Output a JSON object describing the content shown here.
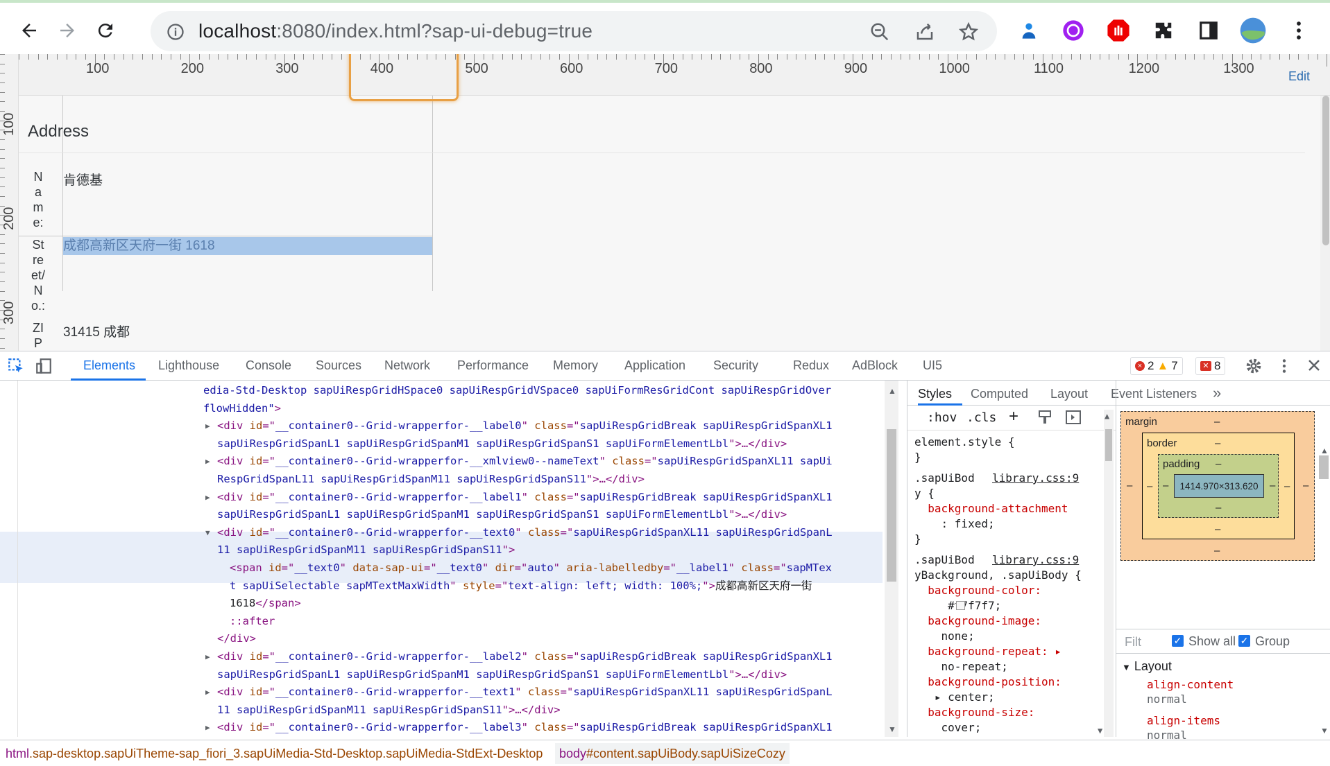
{
  "browser": {
    "url_host": "localhost",
    "url_rest": ":8080/index.html?sap-ui-debug=true",
    "icons": [
      "back-arrow-icon",
      "forward-arrow-icon",
      "reload-icon",
      "info-icon",
      "zoom-out-icon",
      "share-icon",
      "star-icon",
      "extension-person-icon",
      "extension-purple-icon",
      "adblock-icon",
      "puzzle-icon",
      "sidepanel-icon",
      "profile-avatar",
      "kebab-menu-icon"
    ]
  },
  "page": {
    "ruler_top_labels": [
      "100",
      "200",
      "300",
      "400",
      "500",
      "600",
      "700",
      "800",
      "900",
      "1000",
      "1100",
      "1200",
      "1300"
    ],
    "ruler_left_labels": [
      "100",
      "200",
      "300"
    ],
    "edit_link": "Edit",
    "form_title": "Address",
    "fields": [
      {
        "label_lines": [
          "N",
          "a",
          "m",
          "e:"
        ],
        "value": "肯德基"
      },
      {
        "label_lines": [
          "St",
          "re",
          "et/",
          "N",
          "o.:"
        ],
        "value": "成都高新区天府一街 1618"
      },
      {
        "label_lines": [
          "ZI",
          "P"
        ],
        "value": "31415 成都"
      }
    ]
  },
  "devtools": {
    "tabs": [
      "Elements",
      "Lighthouse",
      "Console",
      "Sources",
      "Network",
      "Performance",
      "Memory",
      "Application",
      "Security",
      "Redux",
      "AdBlock",
      "UI5"
    ],
    "active_tab": "Elements",
    "errors": "2",
    "warnings": "7",
    "issues": "8",
    "elements": {
      "lines": [
        {
          "parts": [
            [
              "aval",
              "edia-Std-Desktop sapUiRespGridHSpace0 sapUiRespGridVSpace0 sapUiFormResGridCont sapUiRespGridOver"
            ]
          ]
        },
        {
          "parts": [
            [
              "aval",
              "flowHidden\""
            ],
            [
              "tag",
              ">"
            ]
          ]
        },
        {
          "parts": [
            [
              "tag",
              "<div "
            ],
            [
              "attr",
              "id"
            ],
            [
              "tag",
              "=\""
            ],
            [
              "aval",
              "__container0--Grid-wrapperfor-__label0"
            ],
            [
              "tag",
              "\" "
            ],
            [
              "attr",
              "class"
            ],
            [
              "tag",
              "=\""
            ],
            [
              "aval",
              "sapUiRespGridBreak sapUiRespGridSpanXL1"
            ]
          ]
        },
        {
          "parts": [
            [
              "aval",
              "sapUiRespGridSpanL1 sapUiRespGridSpanM1 sapUiRespGridSpanS1 sapUiFormElementLbl"
            ],
            [
              "tag",
              "\">…</div>"
            ]
          ]
        },
        {
          "parts": [
            [
              "tag",
              "<div "
            ],
            [
              "attr",
              "id"
            ],
            [
              "tag",
              "=\""
            ],
            [
              "aval",
              "__container0--Grid-wrapperfor-__xmlview0--nameText"
            ],
            [
              "tag",
              "\" "
            ],
            [
              "attr",
              "class"
            ],
            [
              "tag",
              "=\""
            ],
            [
              "aval",
              "sapUiRespGridSpanXL11 sapUi"
            ]
          ]
        },
        {
          "parts": [
            [
              "aval",
              "RespGridSpanL11 sapUiRespGridSpanM11 sapUiRespGridSpanS11"
            ],
            [
              "tag",
              "\">…</div>"
            ]
          ]
        },
        {
          "parts": [
            [
              "tag",
              "<div "
            ],
            [
              "attr",
              "id"
            ],
            [
              "tag",
              "=\""
            ],
            [
              "aval",
              "__container0--Grid-wrapperfor-__label1"
            ],
            [
              "tag",
              "\" "
            ],
            [
              "attr",
              "class"
            ],
            [
              "tag",
              "=\""
            ],
            [
              "aval",
              "sapUiRespGridBreak sapUiRespGridSpanXL1"
            ]
          ]
        },
        {
          "parts": [
            [
              "aval",
              "sapUiRespGridSpanL1 sapUiRespGridSpanM1 sapUiRespGridSpanS1 sapUiFormElementLbl"
            ],
            [
              "tag",
              "\">…</div>"
            ]
          ]
        },
        {
          "parts": [
            [
              "tag",
              "<div "
            ],
            [
              "attr",
              "id"
            ],
            [
              "tag",
              "=\""
            ],
            [
              "aval",
              "__container0--Grid-wrapperfor-__text0"
            ],
            [
              "tag",
              "\" "
            ],
            [
              "attr",
              "class"
            ],
            [
              "tag",
              "=\""
            ],
            [
              "aval",
              "sapUiRespGridSpanXL11 sapUiRespGridSpanL"
            ]
          ]
        },
        {
          "parts": [
            [
              "aval",
              "11 sapUiRespGridSpanM11 sapUiRespGridSpanS11"
            ],
            [
              "tag",
              "\">"
            ]
          ]
        },
        {
          "parts": [
            [
              "tag",
              "<span "
            ],
            [
              "attr",
              "id"
            ],
            [
              "tag",
              "=\""
            ],
            [
              "aval",
              "__text0"
            ],
            [
              "tag",
              "\" "
            ],
            [
              "attr",
              "data-sap-ui"
            ],
            [
              "tag",
              "=\""
            ],
            [
              "aval",
              "__text0"
            ],
            [
              "tag",
              "\" "
            ],
            [
              "attr",
              "dir"
            ],
            [
              "tag",
              "=\""
            ],
            [
              "aval",
              "auto"
            ],
            [
              "tag",
              "\" "
            ],
            [
              "attr",
              "aria-labelledby"
            ],
            [
              "tag",
              "=\""
            ],
            [
              "aval",
              "__label1"
            ],
            [
              "tag",
              "\" "
            ],
            [
              "attr",
              "class"
            ],
            [
              "tag",
              "=\""
            ],
            [
              "aval",
              "sapMTex"
            ]
          ]
        },
        {
          "parts": [
            [
              "aval",
              "t sapUiSelectable sapMTextMaxWidth"
            ],
            [
              "tag",
              "\" "
            ],
            [
              "attr",
              "style"
            ],
            [
              "tag",
              "=\""
            ],
            [
              "aval",
              "text-align: left; width: 100%;"
            ],
            [
              "tag",
              "\">"
            ],
            [
              "txt",
              "成都高新区天府一街"
            ]
          ]
        },
        {
          "parts": [
            [
              "txt",
              "1618"
            ],
            [
              "tag",
              "</span>"
            ]
          ]
        },
        {
          "parts": [
            [
              "tag",
              "::after"
            ]
          ]
        },
        {
          "parts": [
            [
              "tag",
              "</div>"
            ]
          ]
        },
        {
          "parts": [
            [
              "tag",
              "<div "
            ],
            [
              "attr",
              "id"
            ],
            [
              "tag",
              "=\""
            ],
            [
              "aval",
              "__container0--Grid-wrapperfor-__label2"
            ],
            [
              "tag",
              "\" "
            ],
            [
              "attr",
              "class"
            ],
            [
              "tag",
              "=\""
            ],
            [
              "aval",
              "sapUiRespGridBreak sapUiRespGridSpanXL1"
            ]
          ]
        },
        {
          "parts": [
            [
              "aval",
              "sapUiRespGridSpanL1 sapUiRespGridSpanM1 sapUiRespGridSpanS1 sapUiFormElementLbl"
            ],
            [
              "tag",
              "\">…</div>"
            ]
          ]
        },
        {
          "parts": [
            [
              "tag",
              "<div "
            ],
            [
              "attr",
              "id"
            ],
            [
              "tag",
              "=\""
            ],
            [
              "aval",
              "__container0--Grid-wrapperfor-__text1"
            ],
            [
              "tag",
              "\" "
            ],
            [
              "attr",
              "class"
            ],
            [
              "tag",
              "=\""
            ],
            [
              "aval",
              "sapUiRespGridSpanXL11 sapUiRespGridSpanL"
            ]
          ]
        },
        {
          "parts": [
            [
              "aval",
              "11 sapUiRespGridSpanM11 sapUiRespGridSpanS11"
            ],
            [
              "tag",
              "\">…</div>"
            ]
          ]
        },
        {
          "parts": [
            [
              "tag",
              "<div "
            ],
            [
              "attr",
              "id"
            ],
            [
              "tag",
              "=\""
            ],
            [
              "aval",
              "__container0--Grid-wrapperfor-__label3"
            ],
            [
              "tag",
              "\" "
            ],
            [
              "attr",
              "class"
            ],
            [
              "tag",
              "=\""
            ],
            [
              "aval",
              "sapUiRespGridBreak sapUiRespGridSpanXL1"
            ]
          ]
        }
      ]
    },
    "styles": {
      "sub_tabs": [
        "Styles",
        "Computed",
        "Layout",
        "Event Listeners"
      ],
      "hov": ":hov",
      "cls": ".cls",
      "rules": [
        [
          "sel",
          "element.style {"
        ],
        [
          "sel",
          "}"
        ],
        [
          "sel",
          ".sapUiBod"
        ],
        [
          "sel",
          "y {"
        ],
        [
          "prop",
          "  background-attachment"
        ],
        [
          "pval",
          "    : fixed;"
        ],
        [
          "sel",
          "}"
        ],
        [
          "sel",
          ".sapUiBod"
        ],
        [
          "sel",
          "yBackground, .sapUiBody {"
        ],
        [
          "prop",
          "  background-color:"
        ],
        [
          "pval",
          "     #f7f7f7;"
        ],
        [
          "prop",
          "  background-image:"
        ],
        [
          "pval",
          "    none;"
        ],
        [
          "prop",
          "  background-repeat: ▸"
        ],
        [
          "pval",
          "    no-repeat;"
        ],
        [
          "prop",
          "  background-position:"
        ],
        [
          "pval",
          "   ▸ center;"
        ],
        [
          "prop",
          "  background-size:"
        ],
        [
          "pval",
          "    cover;"
        ]
      ],
      "source_link": "library.css:9"
    },
    "box_model": {
      "margin": "margin",
      "border": "border",
      "padding": "padding",
      "content": "1414.970×313.620",
      "dash": "–",
      "filter_placeholder": "Filt",
      "show_all": "Show all",
      "group": "Group",
      "layout_section": "Layout",
      "computed": [
        [
          "align-content",
          "normal"
        ],
        [
          "align-items",
          "normal"
        ]
      ]
    },
    "breadcrumb": {
      "html_tag": "html",
      "html_classes": ".sap-desktop.sapUiTheme-sap_fiori_3.sapUiMedia-Std-Desktop.sapUiMedia-StdExt-Desktop",
      "body_tag": "body",
      "body_id": "#content.sapUiBody.sapUiSizeCozy"
    }
  }
}
